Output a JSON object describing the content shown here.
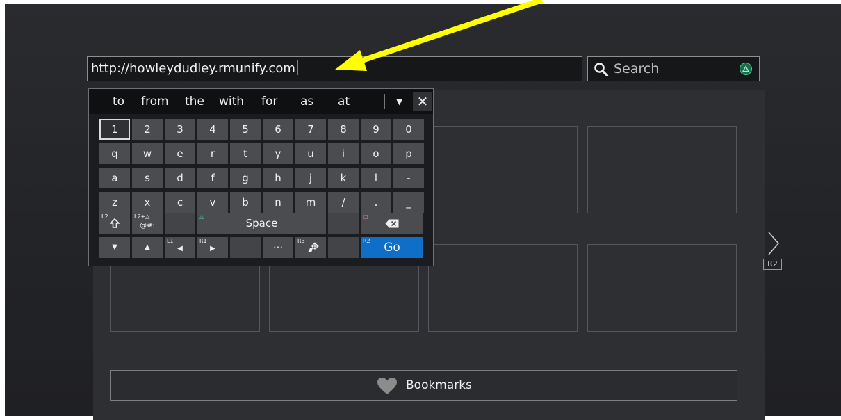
{
  "browser": {
    "url_value": "http://howleydudley.rmunify.com",
    "search_placeholder": "Search",
    "next_page_badge": "R2",
    "bookmarks_label": "Bookmarks"
  },
  "keyboard": {
    "suggestions": [
      "to",
      "from",
      "the",
      "with",
      "for",
      "as",
      "at"
    ],
    "rows": [
      [
        "1",
        "2",
        "3",
        "4",
        "5",
        "6",
        "7",
        "8",
        "9",
        "0"
      ],
      [
        "q",
        "w",
        "e",
        "r",
        "t",
        "y",
        "u",
        "i",
        "o",
        "p"
      ],
      [
        "a",
        "s",
        "d",
        "f",
        "g",
        "h",
        "j",
        "k",
        "l",
        "-"
      ],
      [
        "z",
        "x",
        "c",
        "v",
        "b",
        "n",
        "m",
        "/",
        ".",
        "_"
      ]
    ],
    "special": {
      "shift_tag": "L2",
      "symbols_tag": "L2+△",
      "symbols_label": "@#:",
      "space_tag": "△",
      "space_label": "Space",
      "backspace_tag": "□",
      "cursor_left_tag": "L1",
      "cursor_right_tag": "R1",
      "more_label": "···",
      "r3_tag": "R3",
      "go_tag": "R2",
      "go_label": "Go"
    }
  },
  "annotation": {
    "arrow_color": "#ffff00"
  },
  "colors": {
    "accent_blue": "#0f6fc6",
    "triangle_green": "#3fcf9c"
  }
}
